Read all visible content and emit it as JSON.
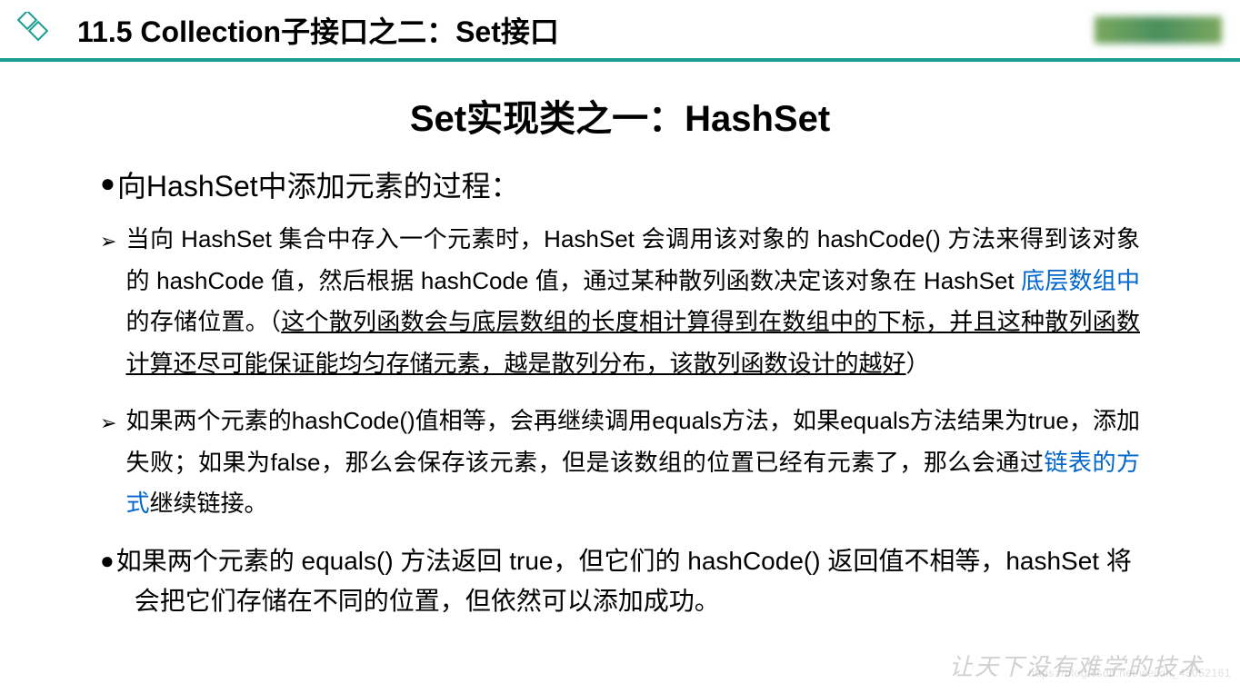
{
  "header": {
    "title": "11.5 Collection子接口之二：Set接口"
  },
  "main_title": "Set实现类之一：HashSet",
  "section_heading": "向HashSet中添加元素的过程：",
  "point1": {
    "text_part1": "当向 HashSet 集合中存入一个元素时，HashSet 会调用该对象的 hashCode() 方法来得到该对象的 hashCode 值，然后根据 hashCode 值，通过某种散列函数决定该对象在 HashSet ",
    "blue1": "底层数组中",
    "text_part2": "的存储位置。（",
    "underline": "这个散列函数会与底层数组的长度相计算得到在数组中的下标，并且这种散列函数计算还尽可能保证能均匀存储元素，越是散列分布，该散列函数设计的越好",
    "text_part3": "）"
  },
  "point2": {
    "text_part1": "如果两个元素的hashCode()值相等，会再继续调用equals方法，如果equals方法结果为true，添加失败；如果为false，那么会保存该元素，但是该数组的位置已经有元素了，那么会通过",
    "blue1": "链表的方式",
    "text_part2": "继续链接。"
  },
  "point3": "如果两个元素的 equals() 方法返回 true，但它们的 hashCode() 返回值不相等，hashSet 将会把它们存储在不同的位置，但依然可以添加成功。",
  "watermark": "让天下没有难学的技术",
  "watermark_small": "https://blog.csdn.net/weixin_43052161"
}
